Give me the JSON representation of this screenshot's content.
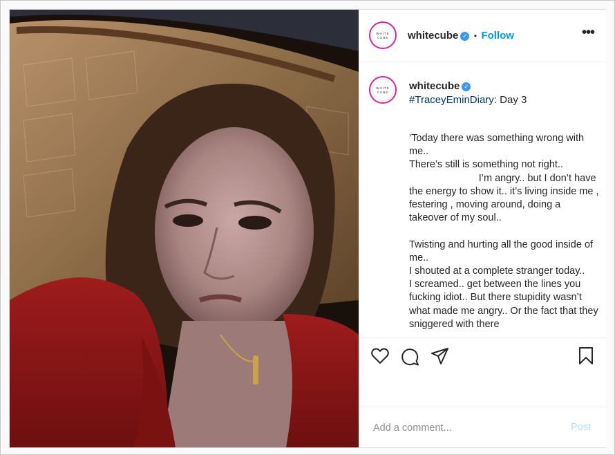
{
  "post": {
    "username": "whitecube",
    "follow_label": "Follow",
    "separator": "•",
    "avatar_text": "WHITE CUBE"
  },
  "caption": {
    "username": "whitecube",
    "hashtag": "#TraceyEminDiary",
    "title_suffix": ": Day 3",
    "body": "‘Today there was something wrong with me..\nThere’s still is something not right..\n                         I’m angry.. but I don’t have the energy to show it.. it’s living inside me , festering , moving around, doing a takeover of my soul..\n\nTwisting and hurting all the good inside of me..\nI shouted at a complete stranger today..\nI screamed.. get between the lines you fucking idiot.. But there stupidity wasn’t what made me angry.. Or the fact that they sniggered with there"
  },
  "actions": {
    "like": "heart-icon",
    "comment": "comment-bubble-icon",
    "share": "paper-plane-icon",
    "save": "bookmark-icon"
  },
  "comment_box": {
    "placeholder": "Add a comment...",
    "post_label": "Post"
  },
  "colors": {
    "link_blue": "#0095f6",
    "hashtag": "#00376b",
    "post_disabled": "#b3dbff",
    "avatar_ring": "#d6249f"
  }
}
